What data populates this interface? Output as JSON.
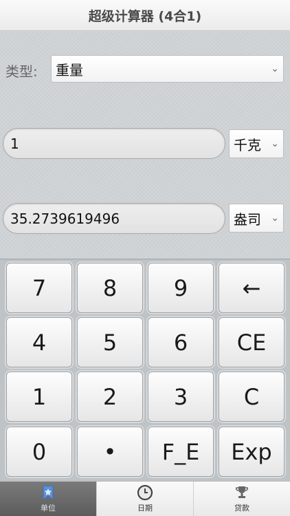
{
  "app": {
    "title": "超级计算器 (4合1)"
  },
  "type_row": {
    "label": "类型:",
    "selected": "重量"
  },
  "input_a": {
    "value": "1",
    "unit": "千克"
  },
  "input_b": {
    "value": "35.2739619496",
    "unit": "盎司"
  },
  "keypad": {
    "keys": [
      [
        "7",
        "8",
        "9",
        "←"
      ],
      [
        "4",
        "5",
        "6",
        "CE"
      ],
      [
        "1",
        "2",
        "3",
        "C"
      ],
      [
        "0",
        "•",
        "F_E",
        "Exp"
      ]
    ]
  },
  "tabs": [
    {
      "label": "单位",
      "icon": "star-icon",
      "active": true
    },
    {
      "label": "日期",
      "icon": "clock-icon",
      "active": false
    },
    {
      "label": "贷款",
      "icon": "trophy-icon",
      "active": false
    }
  ],
  "colors": {
    "active_tab": "#6a6a6a",
    "background": "#d3d7da"
  }
}
